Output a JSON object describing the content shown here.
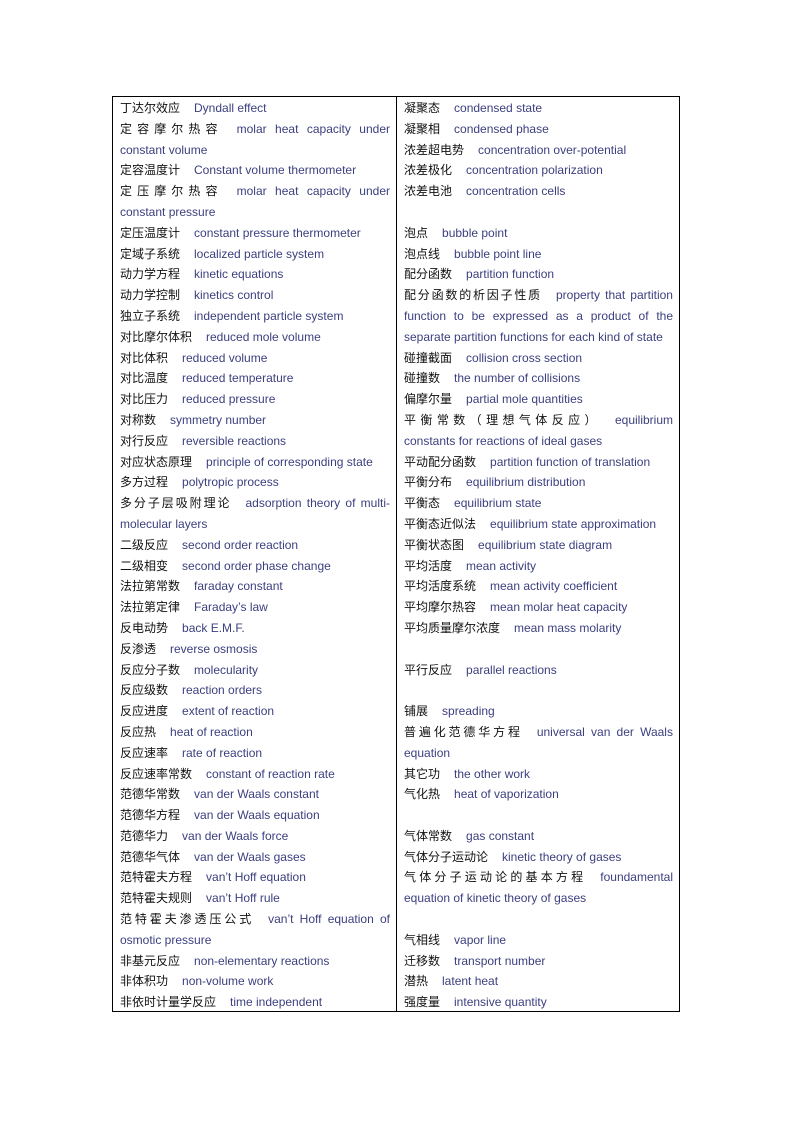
{
  "document": {
    "left_column": [
      {
        "zh": "丁达尔效应",
        "en": "Dyndall effect"
      },
      {
        "zh": "定容摩尔热容",
        "en": "molar heat capacity under constant volume"
      },
      {
        "zh": "定容温度计",
        "en": "Constant voIume thermometer"
      },
      {
        "zh": "定压摩尔热容",
        "en": "molar heat capacity under constant pressure"
      },
      {
        "zh": "定压温度计",
        "en": "constant pressure thermometer"
      },
      {
        "zh": "定域子系统",
        "en": "localized particle system"
      },
      {
        "zh": "动力学方程",
        "en": "kinetic equations"
      },
      {
        "zh": "动力学控制",
        "en": "kinetics control"
      },
      {
        "zh": "独立子系统",
        "en": "independent particle system"
      },
      {
        "zh": "对比摩尔体积",
        "en": "reduced mole volume"
      },
      {
        "zh": "对比体积",
        "en": "reduced volume"
      },
      {
        "zh": "对比温度",
        "en": "reduced temperature"
      },
      {
        "zh": "对比压力",
        "en": "reduced pressure"
      },
      {
        "zh": "对称数",
        "en": "symmetry number"
      },
      {
        "zh": "对行反应",
        "en": "reversible reactions"
      },
      {
        "zh": "对应状态原理",
        "en": "principle of corresponding state"
      },
      {
        "zh": "多方过程",
        "en": "polytropic process"
      },
      {
        "zh": "多分子层吸附理论",
        "en": "adsorption theory of multi-molecular layers"
      },
      {
        "zh": "二级反应",
        "en": "second order reaction"
      },
      {
        "zh": "二级相变",
        "en": "second order phase change"
      },
      {
        "zh": "法拉第常数",
        "en": "faraday constant"
      },
      {
        "zh": "法拉第定律",
        "en": "Faraday’s law"
      },
      {
        "zh": "反电动势",
        "en": "back E.M.F."
      },
      {
        "zh": "反渗透",
        "en": "reverse osmosis"
      },
      {
        "zh": "反应分子数",
        "en": "molecularity"
      },
      {
        "zh": "反应级数",
        "en": "reaction orders"
      },
      {
        "zh": "反应进度",
        "en": "extent of reaction"
      },
      {
        "zh": "反应热",
        "en": "heat of reaction"
      },
      {
        "zh": "反应速率",
        "en": "rate of reaction"
      },
      {
        "zh": "反应速率常数",
        "en": "constant of reaction rate"
      },
      {
        "zh": "范德华常数",
        "en": "van der Waals constant"
      },
      {
        "zh": "范德华方程",
        "en": "van der Waals equation"
      },
      {
        "zh": "范德华力",
        "en": "van der Waals force"
      },
      {
        "zh": "范德华气体",
        "en": "van der Waals gases"
      },
      {
        "zh": "范特霍夫方程",
        "en": "van’t Hoff equation"
      },
      {
        "zh": "范特霍夫规则",
        "en": "van’t Hoff rule"
      },
      {
        "zh": "范特霍夫渗透压公式",
        "en": "van’t Hoff equation of osmotic pressure"
      },
      {
        "zh": "非基元反应",
        "en": "non-elementary reactions"
      },
      {
        "zh": "非体积功",
        "en": "non-volume work"
      },
      {
        "zh": "非依时计量学反应",
        "en": "time independent"
      }
    ],
    "right_column": [
      {
        "zh": "凝聚态",
        "en": "condensed state"
      },
      {
        "zh": "凝聚相",
        "en": "condensed phase"
      },
      {
        "zh": "浓差超电势",
        "en": "concentration over-potential"
      },
      {
        "zh": "浓差极化",
        "en": "concentration polarization"
      },
      {
        "zh": "浓差电池",
        "en": "concentration cells"
      },
      {
        "blank": true
      },
      {
        "zh": "泡点",
        "en": "bubble point"
      },
      {
        "zh": "泡点线",
        "en": "bubble point line"
      },
      {
        "zh": "配分函数",
        "en": "partition function"
      },
      {
        "zh": "配分函数的析因子性质",
        "en": "property that partition function to be expressed as a product of the separate partition functions for each kind of state"
      },
      {
        "zh": "碰撞截面",
        "en": "collision cross section"
      },
      {
        "zh": "碰撞数",
        "en": "the number of collisions"
      },
      {
        "zh": "偏摩尔量",
        "en": "partial mole quantities"
      },
      {
        "zh": "平衡常数（理想气体反应）",
        "en": "equilibrium constants for reactions of ideal gases"
      },
      {
        "zh": "平动配分函数",
        "en": "partition function of translation"
      },
      {
        "zh": "平衡分布",
        "en": "equilibrium distribution"
      },
      {
        "zh": "平衡态",
        "en": "equilibrium state"
      },
      {
        "zh": "平衡态近似法",
        "en": "equilibrium state approximation"
      },
      {
        "zh": "平衡状态图",
        "en": "equilibrium state diagram"
      },
      {
        "zh": "平均活度",
        "en": "mean activity"
      },
      {
        "zh": "平均活度系统",
        "en": "mean activity coefficient"
      },
      {
        "zh": "平均摩尔热容",
        "en": "mean molar heat capacity"
      },
      {
        "zh": "平均质量摩尔浓度",
        "en": "mean mass molarity"
      },
      {
        "blank": true
      },
      {
        "zh": "平行反应",
        "en": "parallel reactions"
      },
      {
        "blank": true
      },
      {
        "zh": "铺展",
        "en": "spreading"
      },
      {
        "zh": "普遍化范德华方程",
        "en": "universal van der Waals equation"
      },
      {
        "zh": "其它功",
        "en": "the other work"
      },
      {
        "zh": "气化热",
        "en": "heat of vaporization"
      },
      {
        "blank": true
      },
      {
        "zh": "气体常数",
        "en": "gas constant"
      },
      {
        "zh": "气体分子运动论",
        "en": "kinetic theory of gases"
      },
      {
        "zh": "气体分子运动论的基本方程",
        "en": "foundamental equation of kinetic theory of gases"
      },
      {
        "blank": true
      },
      {
        "zh": "气相线",
        "en": "vapor line"
      },
      {
        "zh": "迁移数",
        "en": "transport number"
      },
      {
        "zh": "潜热",
        "en": "latent heat"
      },
      {
        "zh": "强度量",
        "en": "intensive quantity"
      }
    ]
  }
}
